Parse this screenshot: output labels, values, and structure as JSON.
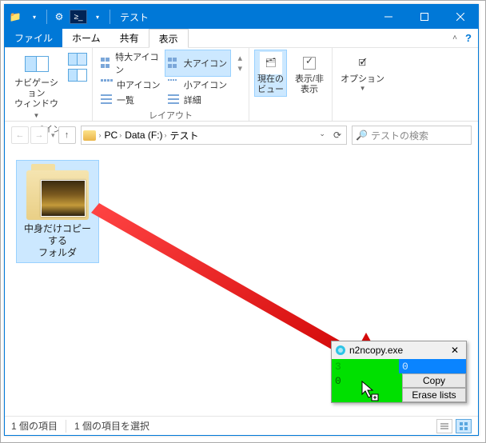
{
  "window": {
    "title": "テスト"
  },
  "quick_access": {
    "ps": "≥_"
  },
  "menu": {
    "file": "ファイル",
    "home": "ホーム",
    "share": "共有",
    "view": "表示"
  },
  "ribbon": {
    "pane": {
      "nav": "ナビゲーション\nウィンドウ",
      "group": "ペイン"
    },
    "layout": {
      "xl_icon": "特大アイコン",
      "l_icon": "大アイコン",
      "m_icon": "中アイコン",
      "s_icon": "小アイコン",
      "list": "一覧",
      "detail": "詳細",
      "group": "レイアウト"
    },
    "views": {
      "curview": "現在の\nビュー",
      "showhide": "表示/非\n表示",
      "options": "オプション"
    }
  },
  "breadcrumb": {
    "pc": "PC",
    "drive": "Data (F:)",
    "folder": "テスト"
  },
  "search": {
    "placeholder": "テストの検索"
  },
  "item": {
    "name": "中身だけコピーする\nフォルダ"
  },
  "status": {
    "count": "1 個の項目",
    "selected": "1 個の項目を選択"
  },
  "popup": {
    "title": "n2ncopy.exe",
    "r1c1": "3",
    "r1c2": "0",
    "r2c1": "0",
    "btn_copy": "Copy",
    "btn_erase": "Erase lists"
  }
}
